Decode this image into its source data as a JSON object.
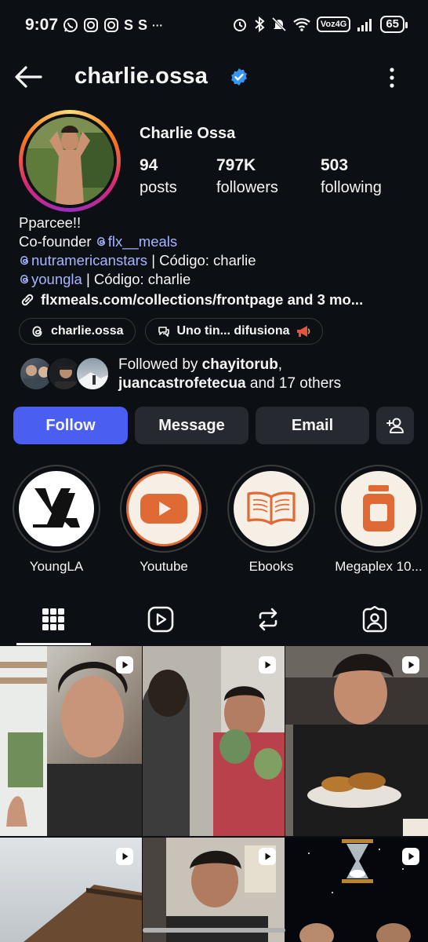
{
  "status_bar": {
    "time": "9:07",
    "left_icons": [
      "whatsapp-icon",
      "instagram-icon",
      "instagram-icon",
      "s-app-icon",
      "s-app-icon",
      "more-icon"
    ],
    "s_label": "S",
    "more_label": "···",
    "network_label": "Voz4G",
    "battery": "65"
  },
  "header": {
    "username": "charlie.ossa",
    "verified": true
  },
  "profile": {
    "full_name": "Charlie Ossa",
    "stats": [
      {
        "value": "94",
        "label": "posts"
      },
      {
        "value": "797K",
        "label": "followers"
      },
      {
        "value": "503",
        "label": "following"
      }
    ],
    "bio": {
      "line1": "Pparcee!!",
      "line2_prefix": "Co-founder ",
      "line2_handle": "flx__meals",
      "line3_handle": "nutramericanstars",
      "line3_suffix": " | Código: charlie",
      "line4_handle": "youngla",
      "line4_suffix": " | Código: charlie",
      "url": "flxmeals.com/collections/frontpage and 3 mo..."
    },
    "chips": [
      {
        "icon": "threads-icon",
        "label": "charlie.ossa"
      },
      {
        "icon": "broadcast-chat-icon",
        "label": "Uno tin... difusiona"
      }
    ],
    "followed_by": {
      "prefix": "Followed by ",
      "user1": "chayitorub",
      "sep": ",",
      "user2": "juancastrofetecua",
      "suffix": " and 17 others"
    }
  },
  "actions": {
    "follow": "Follow",
    "message": "Message",
    "email": "Email"
  },
  "highlights": [
    {
      "label": "YoungLA"
    },
    {
      "label": "Youtube"
    },
    {
      "label": "Ebooks"
    },
    {
      "label": "Megaplex 10..."
    }
  ],
  "tabs": [
    "grid-icon",
    "reels-icon",
    "reposts-icon",
    "tagged-icon"
  ],
  "colors": {
    "background": "#0c1014",
    "follow_button": "#4a5ef0",
    "secondary_button": "#262a30",
    "link": "#a7b4ff",
    "verified": "#3797f0",
    "highlight_accent": "#e06a35"
  }
}
